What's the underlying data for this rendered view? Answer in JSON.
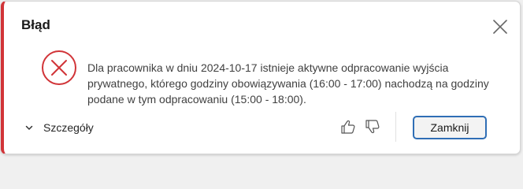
{
  "dialog": {
    "title": "Błąd",
    "message": "Dla pracownika w dniu 2024-10-17 istnieje aktywne odpracowanie wyjścia prywatnego, którego godziny obowiązywania (16:00 - 17:00) nachodzą na godziny podane w tym odpracowaniu (15:00 - 18:00).",
    "details_label": "Szczegóły",
    "close_button_label": "Zamknij"
  },
  "icons": {
    "close": "close-icon",
    "error": "error-icon",
    "chevron": "chevron-down-icon",
    "thumb_up": "thumbs-up-icon",
    "thumb_down": "thumbs-down-icon"
  },
  "colors": {
    "accent_error": "#d13438",
    "focus_border": "#2f6eb5"
  }
}
